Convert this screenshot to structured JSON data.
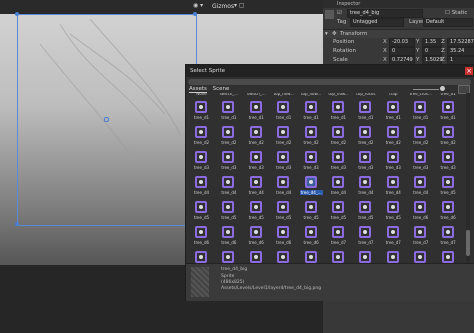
{
  "scene": {
    "gizmos_label": "Gizmos"
  },
  "inspector": {
    "header": "Inspector",
    "object_name": "tree_d4_big",
    "static_label": "Static",
    "tag_label": "Tag",
    "tag_value": "Untagged",
    "layer_label": "Layer",
    "layer_value": "Default",
    "transform_title": "Transform",
    "rows": [
      {
        "label": "Position",
        "x": "-20.03",
        "y": "1.35",
        "z": "17.52287"
      },
      {
        "label": "Rotation",
        "x": "0",
        "y": "0",
        "z": "35.24"
      },
      {
        "label": "Scale",
        "x": "0.72749",
        "y": "1.5029",
        "z": "1"
      }
    ]
  },
  "dialog": {
    "title": "Select Sprite",
    "close_label": "×",
    "tabs": [
      "Assets",
      "Scene"
    ],
    "header_row": [
      "None",
      "switch_...",
      "switch_...",
      "top_flow...",
      "top_flow...",
      "top_flow...",
      "top_rocks",
      "trap",
      "tree_cros...",
      "tree_d1"
    ],
    "rows": [
      [
        "tree_d1",
        "tree_d1",
        "tree_d1",
        "tree_d1",
        "tree_d1",
        "tree_d1",
        "tree_d1",
        "tree_d1",
        "tree_d1",
        "tree_d1"
      ],
      [
        "tree_d2",
        "tree_d2",
        "tree_d2",
        "tree_d2",
        "tree_d2",
        "tree_d2",
        "tree_d2",
        "tree_d2",
        "tree_d2",
        "tree_d2"
      ],
      [
        "tree_d3",
        "tree_d3",
        "tree_d3",
        "tree_d3",
        "tree_d3",
        "tree_d3",
        "tree_d3",
        "tree_d3",
        "tree_d3",
        "tree_d3"
      ],
      [
        "tree_d4",
        "tree_d4",
        "tree_d4",
        "tree_d4",
        "tree_d4_...",
        "tree_d4",
        "tree_d4",
        "tree_d4",
        "tree_d4",
        "tree_d5"
      ],
      [
        "tree_d5",
        "tree_d5",
        "tree_d5",
        "tree_d5",
        "tree_d5",
        "tree_d5",
        "tree_d5",
        "tree_d5",
        "tree_d6",
        "tree_d6"
      ],
      [
        "tree_d6",
        "tree_d6",
        "tree_d6",
        "tree_d6",
        "tree_d6",
        "tree_d7",
        "tree_d7",
        "tree_d7",
        "tree_d7",
        "tree_d7"
      ],
      [
        "tree_d7",
        "tree_d7",
        "tree_d7",
        "tree_d7",
        "tree_d7",
        "tree_d7",
        "tree_d7",
        "tree_d7",
        "tree_d7",
        "tree_d7"
      ]
    ],
    "selected_index": "3:4",
    "footer": {
      "name": "tree_d4_big",
      "type": "Sprite",
      "size": "(486x825)",
      "path": "Assets/Levels/Level1/layer4/tree_d4_big.png"
    }
  }
}
